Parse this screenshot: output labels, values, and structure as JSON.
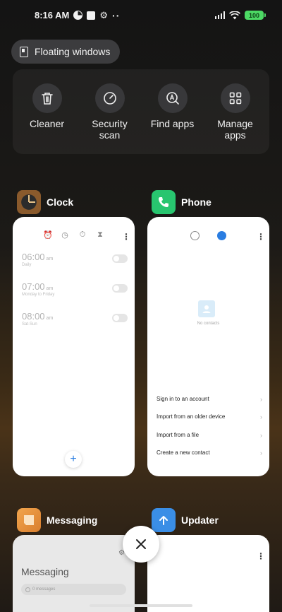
{
  "status_bar": {
    "time": "8:16 AM",
    "battery": "100"
  },
  "floating_windows": {
    "label": "Floating windows"
  },
  "tools": [
    {
      "label": "Cleaner",
      "icon": "trash-icon"
    },
    {
      "label": "Security scan",
      "icon": "gauge-icon"
    },
    {
      "label": "Find apps",
      "icon": "find-app-icon"
    },
    {
      "label": "Manage apps",
      "icon": "grid-icon"
    }
  ],
  "apps": {
    "clock": {
      "name": "Clock",
      "alarms": [
        {
          "time": "06:00",
          "ampm": "am",
          "repeat": "Daily"
        },
        {
          "time": "07:00",
          "ampm": "am",
          "repeat": "Monday to Friday"
        },
        {
          "time": "08:00",
          "ampm": "am",
          "repeat": "Sat-Sun"
        }
      ]
    },
    "phone": {
      "name": "Phone",
      "empty_text": "No contacts",
      "menu": [
        "Sign in to an account",
        "Import from an older device",
        "Import from a file",
        "Create a new contact"
      ]
    },
    "messaging": {
      "name": "Messaging",
      "title": "Messaging",
      "search_placeholder": "0 messages"
    },
    "updater": {
      "name": "Updater"
    }
  },
  "colors": {
    "accent_blue": "#2a7de1",
    "phone_green": "#28c56f",
    "battery_green": "#4cd964"
  }
}
